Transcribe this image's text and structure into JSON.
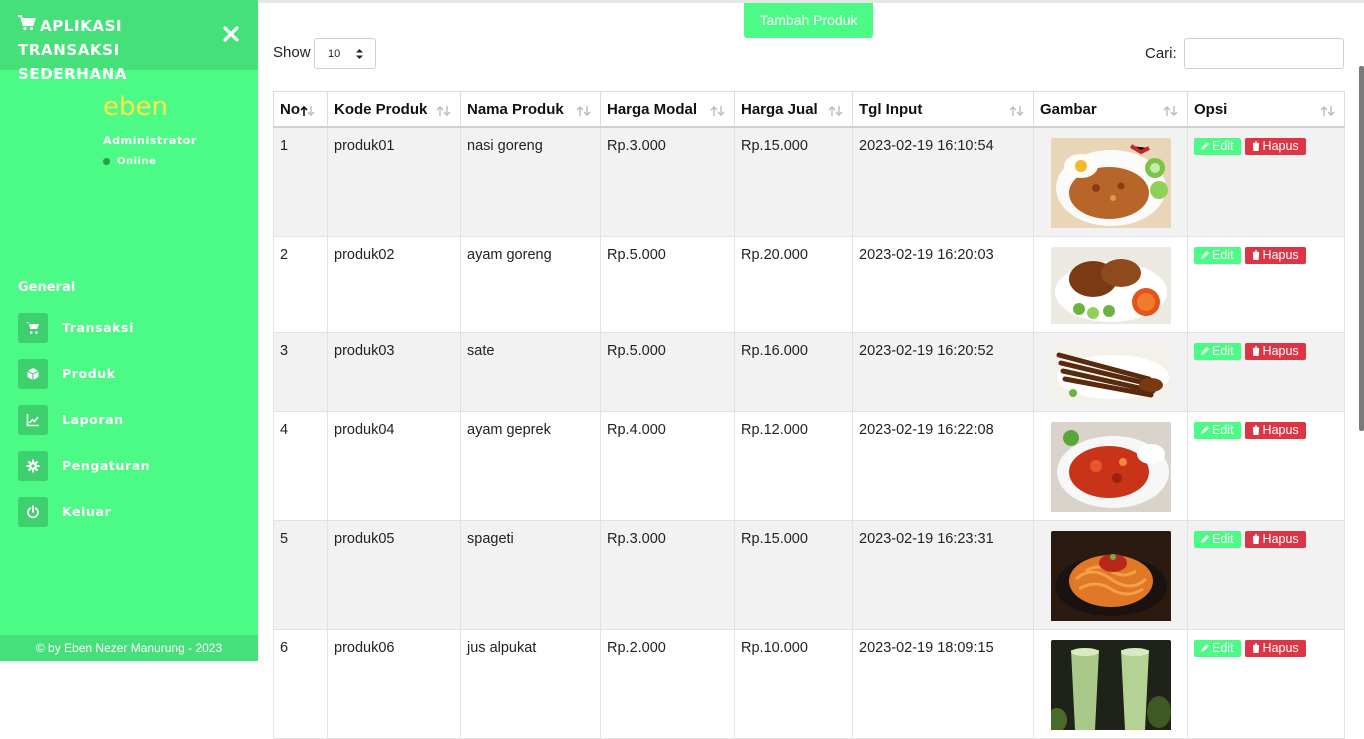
{
  "app": {
    "title": "APLIKASI TRANSAKSI SEDERHANA",
    "footer": "© by Eben Nezer Manurung - 2023"
  },
  "user": {
    "name": "eben",
    "role": "Administrator",
    "status": "Online"
  },
  "sidebar": {
    "section_header": "General",
    "items": [
      {
        "label": "Transaksi",
        "icon": "cart-icon"
      },
      {
        "label": "Produk",
        "icon": "box-icon"
      },
      {
        "label": "Laporan",
        "icon": "chart-icon"
      },
      {
        "label": "Pengaturan",
        "icon": "gear-icon"
      },
      {
        "label": "Keluar",
        "icon": "power-icon"
      }
    ]
  },
  "toolbar": {
    "add_label": "Tambah Produk",
    "show_label": "Show",
    "show_value": "10",
    "search_label": "Cari:",
    "search_value": ""
  },
  "table": {
    "columns": [
      "No",
      "Kode Produk",
      "Nama Produk",
      "Harga Modal",
      "Harga Jual",
      "Tgl Input",
      "Gambar",
      "Opsi"
    ],
    "edit_label": "Edit",
    "delete_label": "Hapus",
    "rows": [
      {
        "no": "1",
        "kode": "produk01",
        "nama": "nasi goreng",
        "modal": "Rp.3.000",
        "jual": "Rp.15.000",
        "tgl": "2023-02-19 16:10:54",
        "gambar": "nasi-goreng-image"
      },
      {
        "no": "2",
        "kode": "produk02",
        "nama": "ayam goreng",
        "modal": "Rp.5.000",
        "jual": "Rp.20.000",
        "tgl": "2023-02-19 16:20:03",
        "gambar": "ayam-goreng-image"
      },
      {
        "no": "3",
        "kode": "produk03",
        "nama": "sate",
        "modal": "Rp.5.000",
        "jual": "Rp.16.000",
        "tgl": "2023-02-19 16:20:52",
        "gambar": "sate-image"
      },
      {
        "no": "4",
        "kode": "produk04",
        "nama": "ayam geprek",
        "modal": "Rp.4.000",
        "jual": "Rp.12.000",
        "tgl": "2023-02-19 16:22:08",
        "gambar": "ayam-geprek-image"
      },
      {
        "no": "5",
        "kode": "produk05",
        "nama": "spageti",
        "modal": "Rp.3.000",
        "jual": "Rp.15.000",
        "tgl": "2023-02-19 16:23:31",
        "gambar": "spageti-image"
      },
      {
        "no": "6",
        "kode": "produk06",
        "nama": "jus alpukat",
        "modal": "Rp.2.000",
        "jual": "Rp.10.000",
        "tgl": "2023-02-19 18:09:15",
        "gambar": "jus-alpukat-image"
      }
    ]
  },
  "colors": {
    "sidebar": "#4cfb85",
    "brand_bar": "#45e07a",
    "accent": "#4cfb85",
    "danger": "#dc3545",
    "name": "#ffe54a"
  }
}
